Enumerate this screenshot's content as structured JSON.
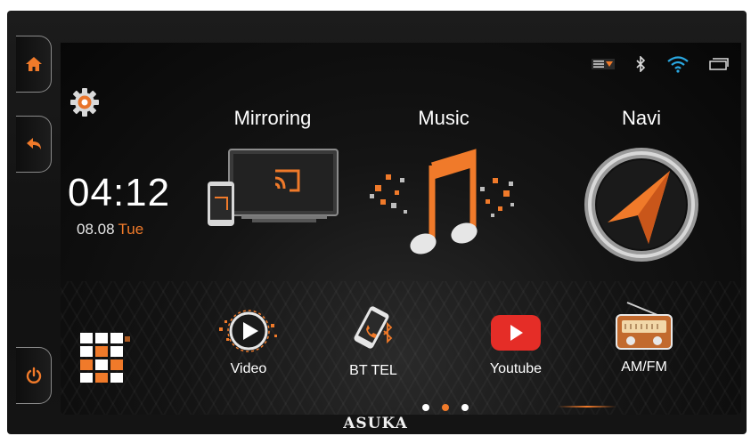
{
  "brand": "ASUKA",
  "side_buttons": [
    {
      "icon": "home-icon"
    },
    {
      "icon": "back-icon"
    },
    {
      "icon": "power-icon"
    }
  ],
  "status_icons": [
    "menu-dropdown-icon",
    "bluetooth-icon",
    "wifi-icon",
    "window-icon"
  ],
  "clock": {
    "time": "04:12",
    "date": "08.08",
    "day": "Tue"
  },
  "settings": {
    "icon": "gear-icon"
  },
  "big_apps": [
    {
      "label": "Mirroring",
      "icon": "mirroring-icon"
    },
    {
      "label": "Music",
      "icon": "music-icon"
    },
    {
      "label": "Navi",
      "icon": "navigation-icon"
    }
  ],
  "small_apps": [
    {
      "label": "Video",
      "icon": "video-play-icon"
    },
    {
      "label": "BT TEL",
      "icon": "bluetooth-phone-icon"
    },
    {
      "label": "Youtube",
      "icon": "youtube-icon"
    },
    {
      "label": "AM/FM",
      "icon": "radio-icon"
    }
  ],
  "apps_grid": {
    "icon": "app-grid-icon"
  },
  "pagination": {
    "pages": 3,
    "current": 2
  },
  "colors": {
    "accent": "#f07a2a",
    "background": "#111111",
    "text": "#ffffff"
  }
}
